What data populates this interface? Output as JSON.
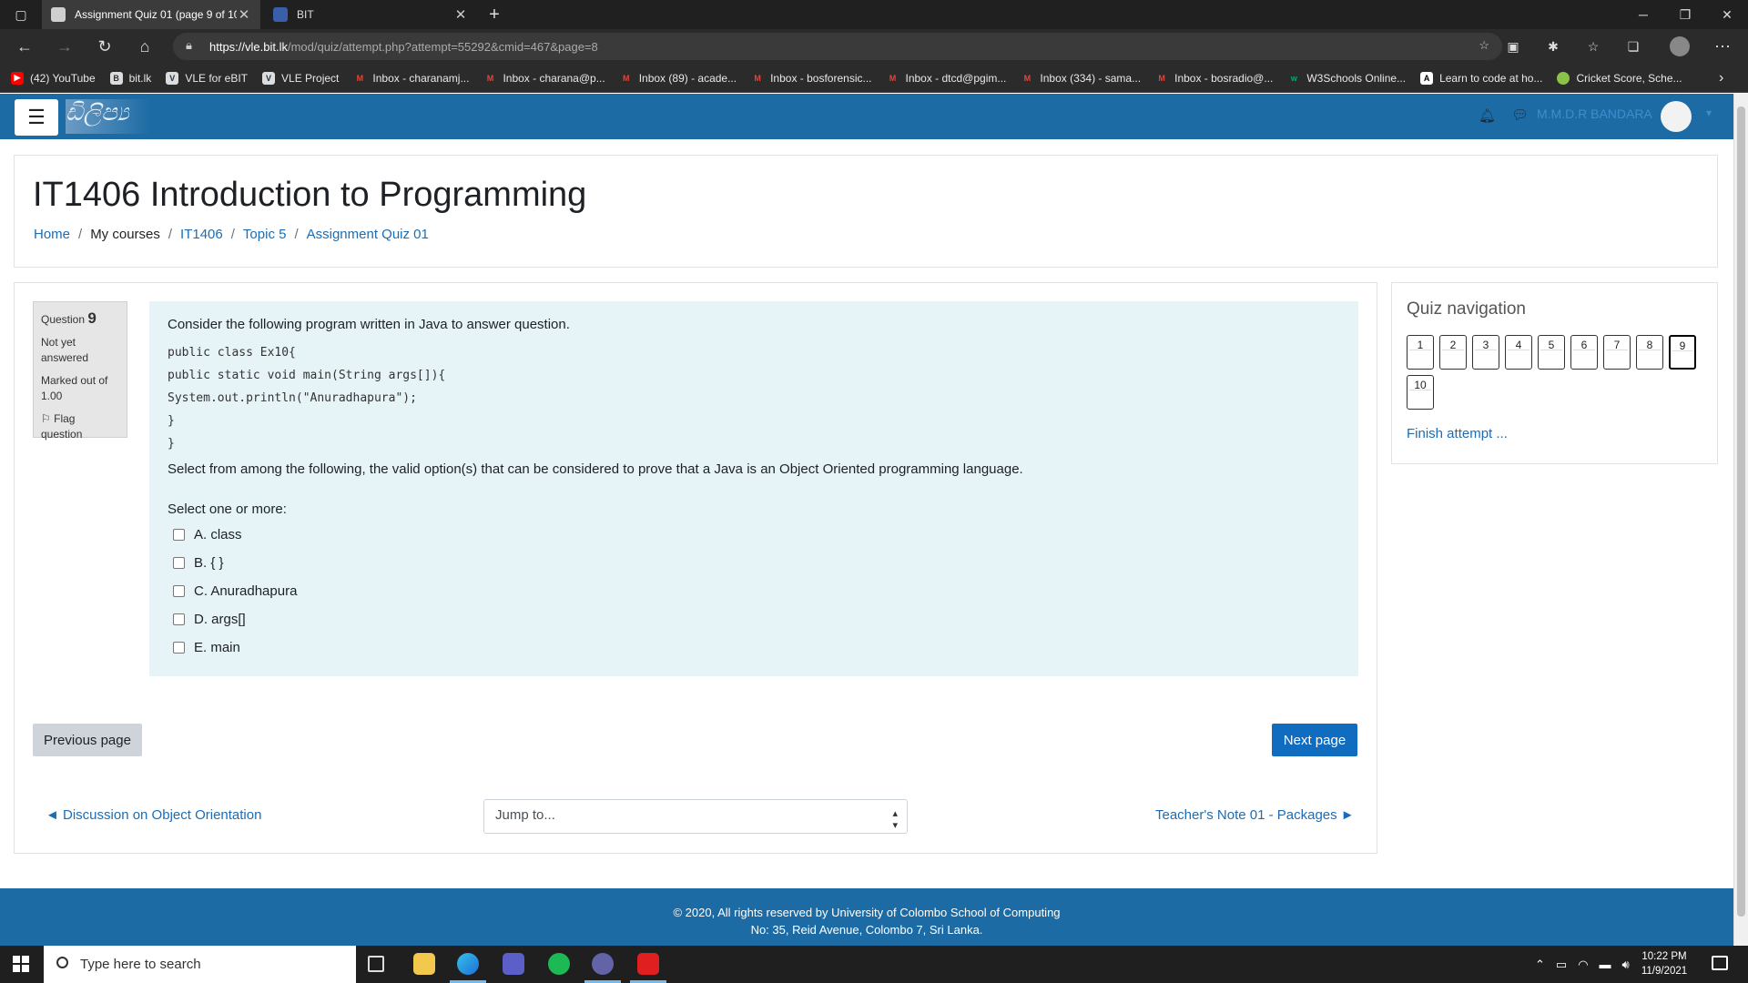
{
  "browser": {
    "tabs": [
      {
        "title": "Assignment Quiz 01 (page 9 of 10)",
        "active": true
      },
      {
        "title": "BIT",
        "active": false
      }
    ],
    "url_host": "https://vle.bit.lk",
    "url_path": "/mod/quiz/attempt.php?attempt=55292&cmid=467&page=8",
    "new_tab": "+",
    "bookmarks": [
      {
        "label": "(42) YouTube",
        "icon": "youtube-icon",
        "color": "#ff0000"
      },
      {
        "label": "bit.lk",
        "icon": "bit-icon",
        "color": "#dddddd"
      },
      {
        "label": "VLE for eBIT",
        "icon": "vle-icon",
        "color": "#dddddd"
      },
      {
        "label": "VLE Project",
        "icon": "vle-icon",
        "color": "#dddddd"
      },
      {
        "label": "Inbox - charanamj...",
        "icon": "gmail-icon",
        "color": "#ea4335"
      },
      {
        "label": "Inbox - charana@p...",
        "icon": "gmail-icon",
        "color": "#ea4335"
      },
      {
        "label": "Inbox (89) - acade...",
        "icon": "gmail-icon",
        "color": "#ea4335"
      },
      {
        "label": "Inbox - bosforensic...",
        "icon": "gmail-icon",
        "color": "#ea4335"
      },
      {
        "label": "Inbox - dtcd@pgim...",
        "icon": "gmail-icon",
        "color": "#ea4335"
      },
      {
        "label": "Inbox (334) - sama...",
        "icon": "gmail-icon",
        "color": "#ea4335"
      },
      {
        "label": "Inbox - bosradio@...",
        "icon": "gmail-icon",
        "color": "#ea4335"
      },
      {
        "label": "W3Schools Online...",
        "icon": "w3schools-icon",
        "color": "#04aa6d"
      },
      {
        "label": "Learn to code at ho...",
        "icon": "freecodecamp-icon",
        "color": "#ffffff"
      },
      {
        "label": "Cricket Score, Sche...",
        "icon": "cricket-icon",
        "color": "#8bc34a"
      }
    ]
  },
  "header": {
    "user_name": "M.M.D.R BANDARA"
  },
  "page": {
    "course_title": "IT1406 Introduction to Programming",
    "breadcrumb": [
      {
        "label": "Home",
        "link": true
      },
      {
        "label": "My courses",
        "link": false
      },
      {
        "label": "IT1406",
        "link": true
      },
      {
        "label": "Topic 5",
        "link": true
      },
      {
        "label": "Assignment Quiz 01",
        "link": true
      }
    ]
  },
  "question": {
    "label": "Question",
    "number": "9",
    "state": "Not yet answered",
    "marks": "Marked out of 1.00",
    "flag": "Flag question",
    "intro": "Consider the following program written in Java to answer question.",
    "code": [
      "public class Ex10{",
      "public static void main(String args[]){",
      "System.out.println(\"Anuradhapura\");",
      "}",
      "}"
    ],
    "prompt": "Select from among the following, the valid option(s) that can be considered to prove that a Java is an Object Oriented programming language.",
    "select_label": "Select one or more:",
    "options": [
      "A. class",
      "B. { }",
      "C. Anuradhapura",
      "D. args[]",
      "E. main"
    ]
  },
  "nav": {
    "prev": "Previous page",
    "next": "Next page",
    "activity_prev": "◄ Discussion on Object Orientation",
    "jump": "Jump to...",
    "activity_next": "Teacher's Note 01 - Packages ►"
  },
  "quiz_nav": {
    "title": "Quiz navigation",
    "buttons": [
      "1",
      "2",
      "3",
      "4",
      "5",
      "6",
      "7",
      "8",
      "9",
      "10"
    ],
    "current": "9",
    "finish": "Finish attempt ..."
  },
  "footer": {
    "line1": "© 2020, All rights reserved by University of Colombo School of Computing",
    "line2": "No: 35, Reid Avenue, Colombo 7, Sri Lanka."
  },
  "taskbar": {
    "search_placeholder": "Type here to search",
    "time": "10:22 PM",
    "date": "11/9/2021"
  }
}
